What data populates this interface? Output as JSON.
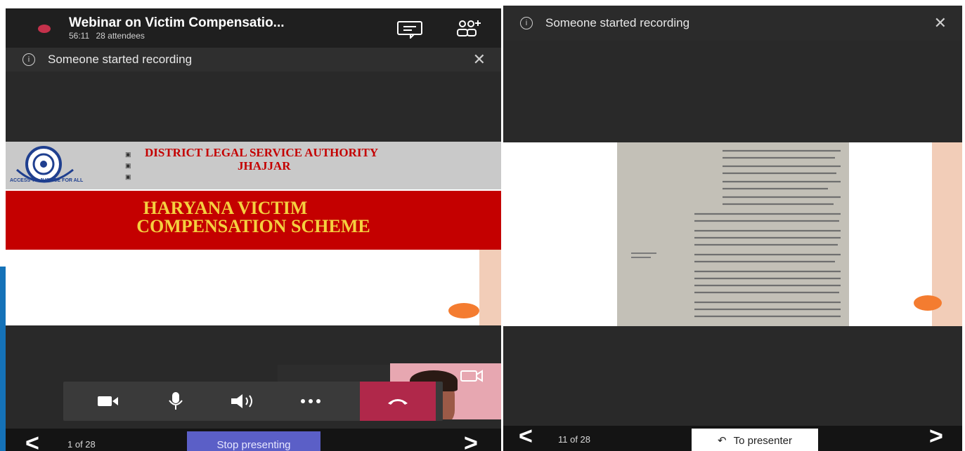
{
  "meeting": {
    "title": "Webinar on Victim Compensatio...",
    "duration": "56:11",
    "attendees": "28 attendees"
  },
  "banner": {
    "text": "Someone started recording",
    "close": "✕"
  },
  "slide": {
    "authority_line1": "DISTRICT LEGAL SERVICE AUTHORITY",
    "authority_line2": "JHAJJAR",
    "logo_text": "ACCESS TO JUSTICE FOR ALL",
    "title_line1": "HARYANA VICTIM",
    "title_line2": "COMPENSATION SCHEME"
  },
  "left_nav": {
    "page": "1 of 28",
    "stop_label": "Stop presenting"
  },
  "right_nav": {
    "page": "11 of 28",
    "to_presenter_label": "To presenter"
  },
  "colors": {
    "dark_bg": "#292929",
    "banner_bg": "#2f2f2f",
    "bottom_bg": "#141414",
    "slide_red": "#c40000",
    "slide_gold": "#f4d03f",
    "hangup": "#b0284a",
    "stop_btn": "#5b5fc7",
    "record_dot": "#c4314b",
    "pointer": "#f47c30"
  }
}
